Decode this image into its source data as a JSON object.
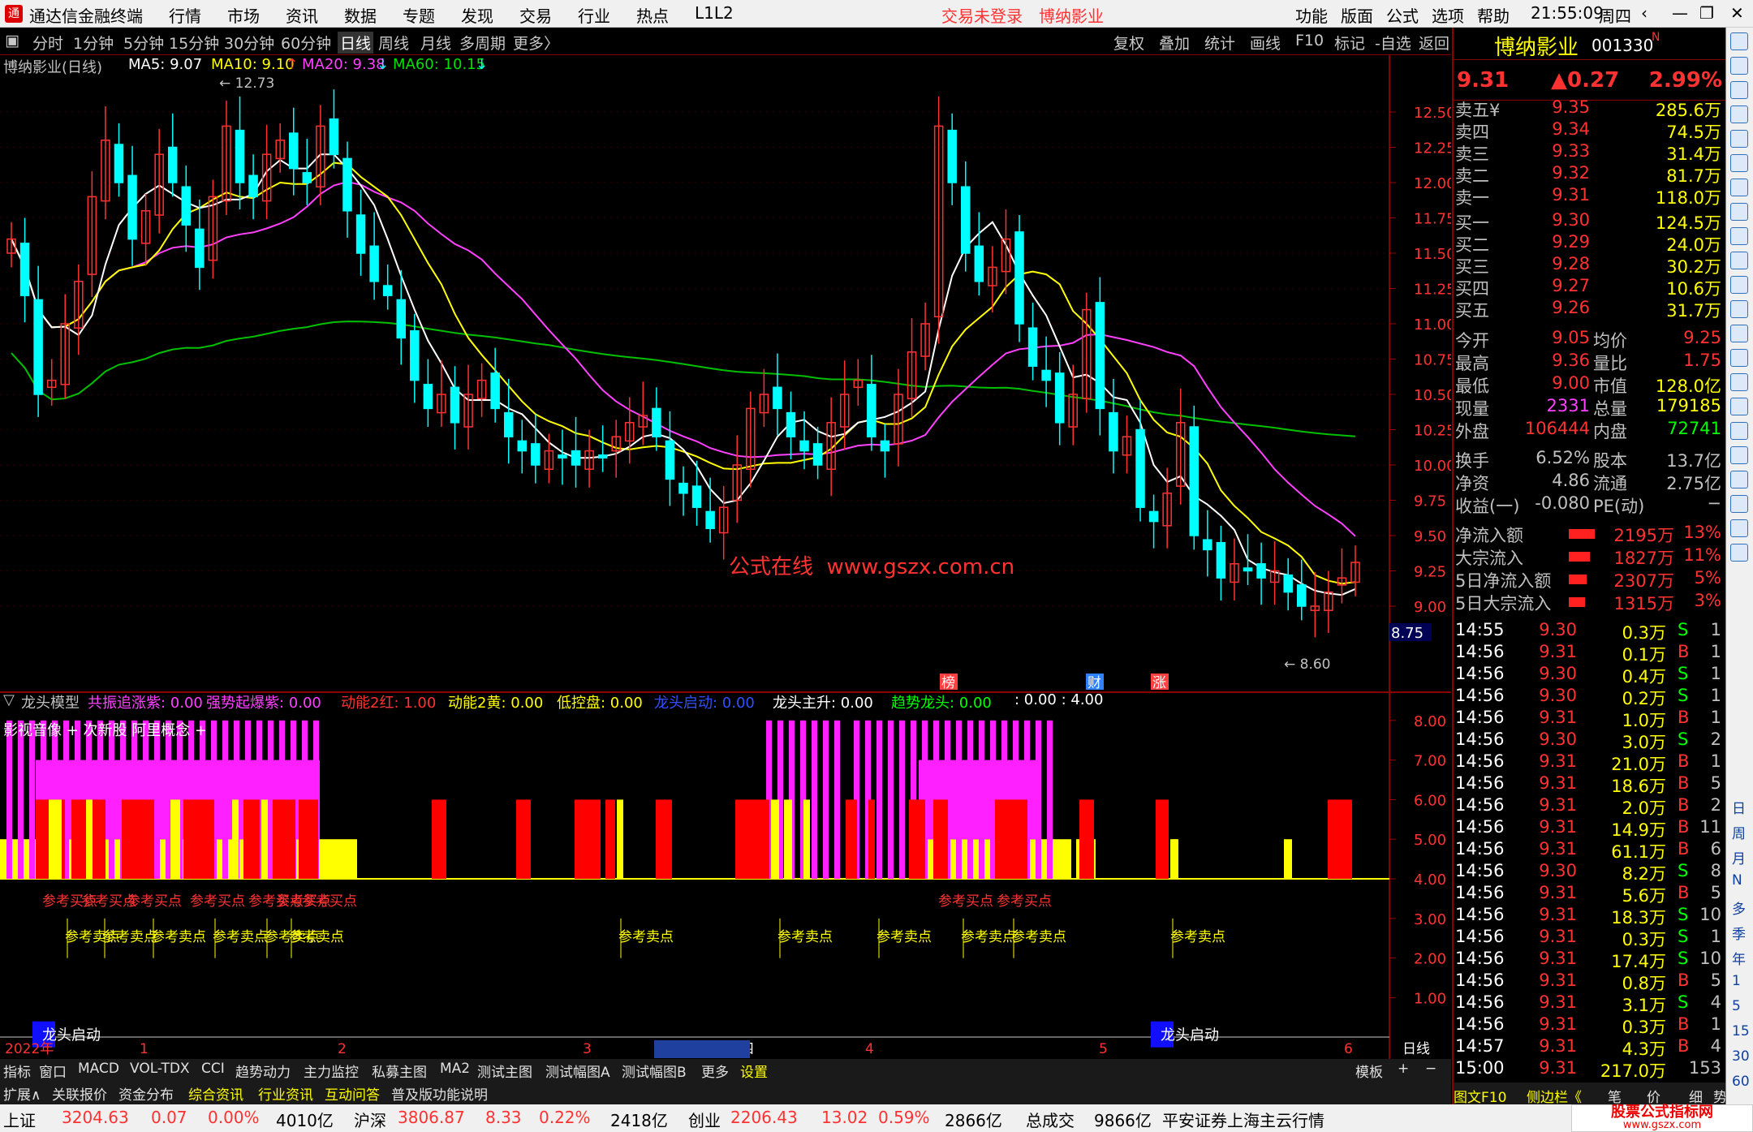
{
  "titlebar": {
    "app": "通达信金融终端",
    "menus": [
      "行情",
      "市场",
      "资讯",
      "数据",
      "专题",
      "发现",
      "交易",
      "行业",
      "热点",
      "L1L2"
    ],
    "status1": "交易未登录",
    "status2": "博纳影业",
    "right_menus": [
      "功能",
      "版面",
      "公式",
      "选项",
      "帮助"
    ],
    "time": "21:55:09",
    "weekday": "周四"
  },
  "periods": [
    "分时",
    "1分钟",
    "5分钟",
    "15分钟",
    "30分钟",
    "60分钟",
    "日线",
    "周线",
    "月线",
    "多周期",
    "更多〉"
  ],
  "tools": [
    "复权",
    "叠加",
    "统计",
    "画线",
    "F10",
    "标记",
    "-自选",
    "返回"
  ],
  "chart": {
    "name": "博纳影业(日线)",
    "ma5": "MA5: 9.07",
    "ma10": "MA10: 9.10",
    "ma20": "MA20: 9.38",
    "ma60": "MA60: 10.15",
    "y_ticks": [
      "12.50",
      "12.25",
      "12.00",
      "11.75",
      "11.50",
      "11.25",
      "11.00",
      "10.75",
      "10.50",
      "10.25",
      "10.00",
      "9.75",
      "9.50",
      "9.25",
      "9.00"
    ],
    "high": "12.73",
    "low": "8.60",
    "cursor_price": "8.75",
    "watermark": "公式在线  www.gszx.com.cn",
    "markers": [
      "榜",
      "财",
      "涨"
    ]
  },
  "indicator": {
    "name": "龙头模型",
    "items": [
      {
        "t": "共振追涨紫: 0.00",
        "c": "#ff40ff"
      },
      {
        "t": "强势起爆紫: 0.00",
        "c": "#ff40ff"
      },
      {
        "t": "动能2红: 1.00",
        "c": "#ff3232"
      },
      {
        "t": "动能2黄: 0.00",
        "c": "#ffff00"
      },
      {
        "t": "低控盘: 0.00",
        "c": "#ffff00"
      },
      {
        "t": "龙头启动: 0.00",
        "c": "#3050ff"
      },
      {
        "t": "龙头主升: 0.00",
        "c": "#ffffff"
      },
      {
        "t": "趋势龙头: 0.00",
        "c": "#00ff00"
      },
      {
        "t": ": 0.00 : 4.00",
        "c": "#ffffff"
      }
    ],
    "y_ticks": [
      "8.00",
      "7.00",
      "6.00",
      "5.00",
      "4.00",
      "3.00",
      "2.00",
      "1.00"
    ],
    "overlay_text": "影视音像 + 次新股 阿里概念 +",
    "buy_label": "参考买点",
    "sell_label": "参考卖点",
    "dragon_label": "龙头启动"
  },
  "xaxis": {
    "labels": [
      "2022年",
      "1",
      "2",
      "3",
      "2023/03/09/四",
      "4",
      "5",
      "6"
    ],
    "period": "日线"
  },
  "bottom_tabs": [
    "指标",
    "窗口",
    "MACD",
    "VOL-TDX",
    "CCI",
    "趋势动力",
    "主力监控",
    "私募主图",
    "MA2",
    "测试主图",
    "测试幅图A",
    "测试幅图B",
    "更多",
    "设置",
    "模板",
    "+",
    "−"
  ],
  "bottom_tabs2": [
    "扩展∧",
    "关联报价",
    "资金分布",
    "综合资讯",
    "行业资讯",
    "互动问答",
    "普及版功能说明"
  ],
  "quote": {
    "name": "博纳影业",
    "code": "001330",
    "flag": "N",
    "price": "9.31",
    "change": "▲0.27",
    "pct": "2.99%",
    "asks": [
      [
        "卖五¥",
        "9.35",
        "285.6万"
      ],
      [
        "卖四",
        "9.34",
        "74.5万"
      ],
      [
        "卖三",
        "9.33",
        "31.4万"
      ],
      [
        "卖二",
        "9.32",
        "81.7万"
      ],
      [
        "卖一",
        "9.31",
        "118.0万"
      ]
    ],
    "bids": [
      [
        "买一",
        "9.30",
        "124.5万"
      ],
      [
        "买二",
        "9.29",
        "24.0万"
      ],
      [
        "买三",
        "9.28",
        "30.2万"
      ],
      [
        "买四",
        "9.27",
        "10.6万"
      ],
      [
        "买五",
        "9.26",
        "31.7万"
      ]
    ],
    "stats": [
      [
        "今开",
        "9.05",
        "均价",
        "9.25"
      ],
      [
        "最高",
        "9.36",
        "量比",
        "1.75"
      ],
      [
        "最低",
        "9.00",
        "市值",
        "128.0亿"
      ],
      [
        "现量",
        "2331",
        "总量",
        "179185"
      ],
      [
        "外盘",
        "106444",
        "内盘",
        "72741"
      ]
    ],
    "stats2": [
      [
        "换手",
        "6.52%",
        "股本",
        "13.7亿"
      ],
      [
        "净资",
        "4.86",
        "流通",
        "2.75亿"
      ],
      [
        "收益(一)",
        "-0.080",
        "PE(动)",
        "−"
      ]
    ],
    "flows": [
      [
        "净流入额",
        "2195万",
        "13%"
      ],
      [
        "大宗流入",
        "1827万",
        "11%"
      ],
      [
        "5日净流入额",
        "2307万",
        "5%"
      ],
      [
        "5日大宗流入",
        "1315万",
        "3%"
      ]
    ],
    "ticks": [
      [
        "14:55",
        "9.30",
        "0.3万",
        "S",
        "1"
      ],
      [
        "14:56",
        "9.31",
        "0.1万",
        "B",
        "1"
      ],
      [
        "14:56",
        "9.30",
        "0.4万",
        "S",
        "1"
      ],
      [
        "14:56",
        "9.30",
        "0.2万",
        "S",
        "1"
      ],
      [
        "14:56",
        "9.31",
        "1.0万",
        "B",
        "1"
      ],
      [
        "14:56",
        "9.30",
        "3.0万",
        "S",
        "2"
      ],
      [
        "14:56",
        "9.31",
        "21.0万",
        "B",
        "1"
      ],
      [
        "14:56",
        "9.31",
        "18.6万",
        "B",
        "5"
      ],
      [
        "14:56",
        "9.31",
        "2.0万",
        "B",
        "2"
      ],
      [
        "14:56",
        "9.31",
        "14.9万",
        "B",
        "11"
      ],
      [
        "14:56",
        "9.31",
        "61.1万",
        "B",
        "6"
      ],
      [
        "14:56",
        "9.30",
        "8.2万",
        "S",
        "8"
      ],
      [
        "14:56",
        "9.31",
        "5.6万",
        "B",
        "5"
      ],
      [
        "14:56",
        "9.31",
        "18.3万",
        "S",
        "10"
      ],
      [
        "14:56",
        "9.31",
        "0.3万",
        "S",
        "1"
      ],
      [
        "14:56",
        "9.31",
        "17.4万",
        "S",
        "10"
      ],
      [
        "14:56",
        "9.31",
        "0.8万",
        "B",
        "5"
      ],
      [
        "14:56",
        "9.31",
        "3.1万",
        "S",
        "4"
      ],
      [
        "14:56",
        "9.31",
        "0.3万",
        "B",
        "1"
      ],
      [
        "14:57",
        "9.31",
        "4.3万",
        "B",
        "4"
      ],
      [
        "15:00",
        "9.31",
        "217.0万",
        "",
        "153"
      ]
    ],
    "bottom_btns": [
      "图文F10",
      "侧边栏《",
      "笔",
      "价",
      "细",
      "势"
    ]
  },
  "rightbar": [
    "日",
    "周",
    "月",
    "N",
    "多",
    "季",
    "年",
    "1",
    "5",
    "15",
    "30",
    "60"
  ],
  "status": {
    "sh": "上证",
    "sh_v": "3204.63",
    "sh_c": "0.07",
    "sh_p": "0.00%",
    "sh_a": "4010亿",
    "sz": "沪深",
    "sz_v": "3806.87",
    "sz_c": "8.33",
    "sz_p": "0.22%",
    "sz_a": "2418亿",
    "cy": "创业",
    "cy_v": "2206.43",
    "cy_c": "13.02",
    "cy_p": "0.59%",
    "cy_a": "2866亿",
    "zcj": "总成交",
    "zcj_v": "9866亿",
    "broker": "平安证券上海主云行情",
    "logo": "股票公式指标网",
    "logo_url": "www.gszx.com"
  }
}
